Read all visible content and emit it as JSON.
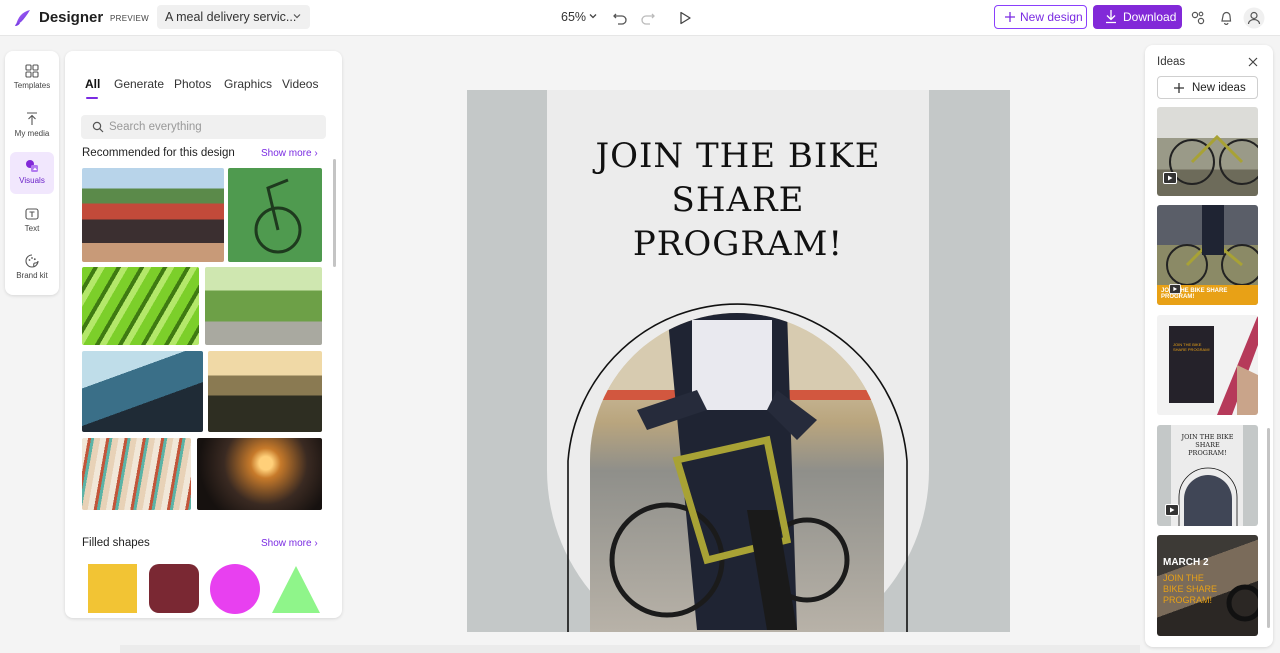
{
  "app": {
    "name": "Designer",
    "badge": "PREVIEW",
    "doc_title": "A meal delivery servic...",
    "zoom": "65%",
    "new_design_label": "New design",
    "download_label": "Download",
    "accent": "#8229d8"
  },
  "rail": {
    "items": [
      {
        "label": "Templates",
        "icon": "templates-icon"
      },
      {
        "label": "My media",
        "icon": "upload-icon"
      },
      {
        "label": "Visuals",
        "icon": "visuals-icon",
        "active": true
      },
      {
        "label": "Text",
        "icon": "text-icon"
      },
      {
        "label": "Brand kit",
        "icon": "brand-kit-icon"
      }
    ]
  },
  "panel": {
    "tabs": [
      "All",
      "Generate",
      "Photos",
      "Graphics",
      "Videos"
    ],
    "active_tab": "All",
    "search_placeholder": "Search everything",
    "recommended_title": "Recommended for this design",
    "show_more": "Show more",
    "filled_shapes_title": "Filled shapes",
    "shape_colors": [
      "#f2c434",
      "#7a2833",
      "#e840f0",
      "#8ff58a"
    ]
  },
  "canvas": {
    "poster_title": [
      "JOIN THE BIKE",
      "SHARE",
      "PROGRAM!"
    ]
  },
  "ideas": {
    "title": "Ideas",
    "new_ideas_label": "New ideas",
    "card2_caption": [
      "JOIN THE BIKE SHARE",
      "PROGRAM!"
    ],
    "card3_caption": [
      "JOIN THE BIKE",
      "SHARE PROGRAM!"
    ],
    "card4_caption": [
      "JOIN THE BIKE",
      "SHARE",
      "PROGRAM!"
    ],
    "card5_caption": [
      "MARCH 2",
      "JOIN THE",
      "BIKE SHARE",
      "PROGRAM!"
    ]
  }
}
